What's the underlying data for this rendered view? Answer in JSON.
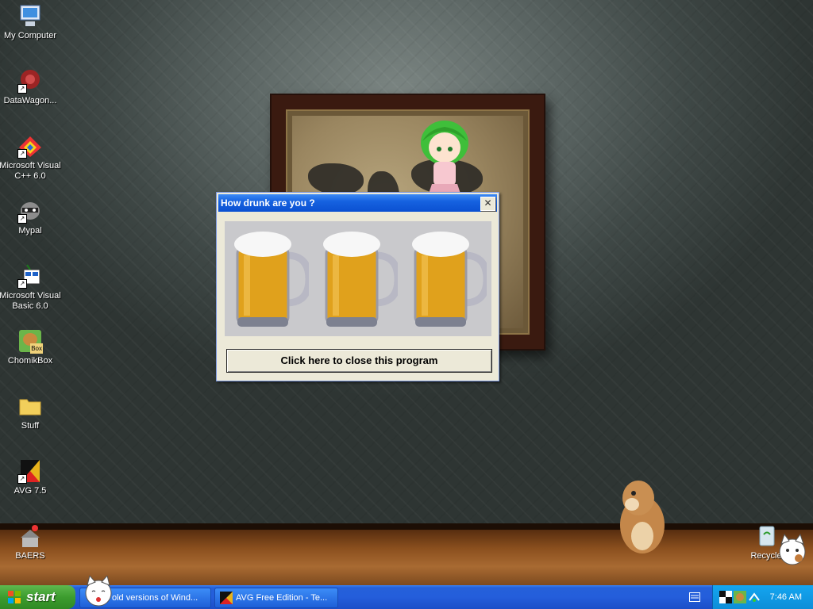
{
  "desktop": {
    "icons": [
      {
        "label": "My Computer"
      },
      {
        "label": "DataWagon..."
      },
      {
        "label": "Microsoft Visual C++ 6.0"
      },
      {
        "label": "Mypal"
      },
      {
        "label": "Microsoft Visual Basic 6.0"
      },
      {
        "label": "ChomikBox"
      },
      {
        "label": "Stuff"
      },
      {
        "label": "AVG 7.5"
      },
      {
        "label": "BAERS"
      },
      {
        "label": "Recycle"
      }
    ],
    "chomikbox_badge": "Box"
  },
  "dialog": {
    "title": "How drunk are you ?",
    "close_glyph": "✕",
    "button_label": "Click here to close this program"
  },
  "taskbar": {
    "start_label": "start",
    "buttons": [
      {
        "label": "old versions of Wind..."
      },
      {
        "label": "AVG Free Edition - Te..."
      }
    ],
    "clock": "7:46 AM"
  },
  "colors": {
    "titlebar": "#0b50d1",
    "taskbar": "#245edb",
    "start": "#3c9c2e",
    "beer": "#e0a11c"
  }
}
